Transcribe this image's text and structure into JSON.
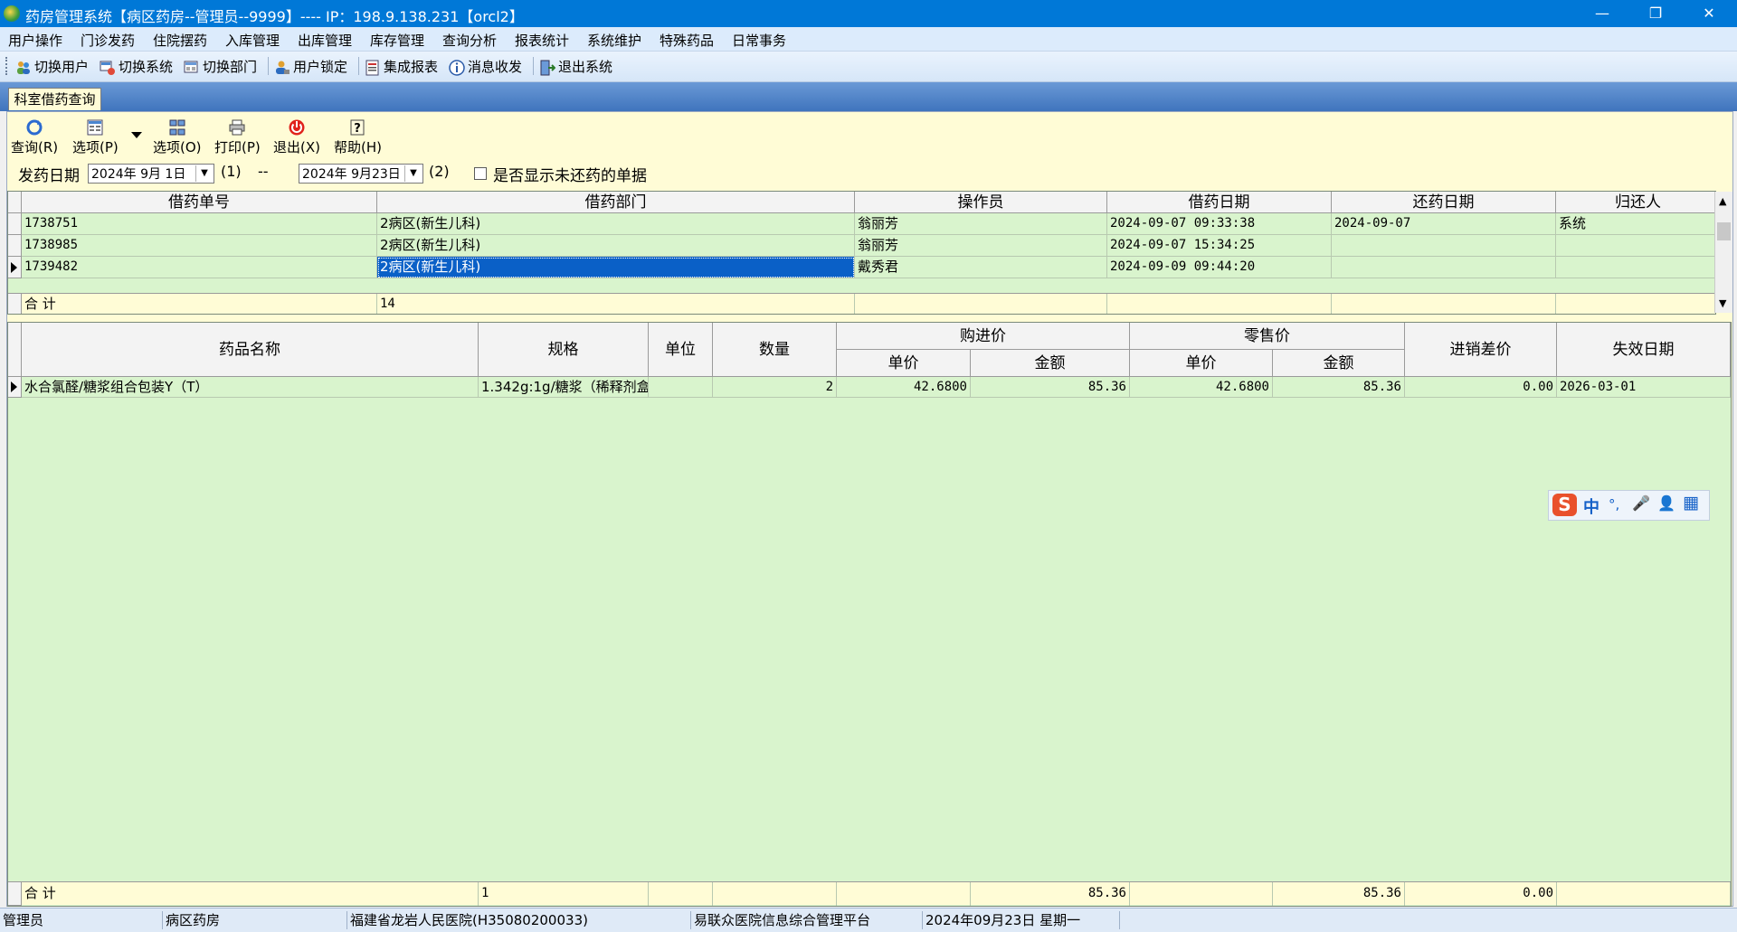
{
  "window": {
    "title": "药房管理系统【病区药房--管理员--9999】---- IP：198.9.138.231【orcl2】",
    "minimize": "—",
    "restore": "❐",
    "close": "✕"
  },
  "menu": [
    "用户操作",
    "门诊发药",
    "住院摆药",
    "入库管理",
    "出库管理",
    "库存管理",
    "查询分析",
    "报表统计",
    "系统维护",
    "特殊药品",
    "日常事务"
  ],
  "toolbar": [
    "切换用户",
    "切换系统",
    "切换部门",
    "用户锁定",
    "集成报表",
    "消息收发",
    "退出系统"
  ],
  "tab": {
    "label": "科室借药查询"
  },
  "actions": {
    "query": "查询(R)",
    "option_p": "选项(P)",
    "option_o": "选项(O)",
    "print": "打印(P)",
    "exit": "退出(X)",
    "help": "帮助(H)"
  },
  "filter": {
    "date_label": "发药日期",
    "date_from": "2024年 9月 1日",
    "date_from_key": "(1)",
    "dash": "--",
    "date_to": "2024年 9月23日",
    "date_to_key": "(2)",
    "show_unreturned_label": "是否显示未还药的单据",
    "show_unreturned_checked": false
  },
  "loan_table": {
    "columns": [
      "借药单号",
      "借药部门",
      "操作员",
      "借药日期",
      "还药日期",
      "归还人"
    ],
    "rows": [
      [
        "1738751",
        "2病区(新生儿科)",
        "翁丽芳",
        "2024-09-07 09:33:38",
        "2024-09-07",
        "系统"
      ],
      [
        "1738985",
        "2病区(新生儿科)",
        "翁丽芳",
        "2024-09-07 15:34:25",
        "",
        ""
      ],
      [
        "1739482",
        "2病区(新生儿科)",
        "戴秀君",
        "2024-09-09 09:44:20",
        "",
        ""
      ]
    ],
    "total_label": "合  计",
    "total_value": "14"
  },
  "detail_table": {
    "columns": {
      "name": "药品名称",
      "spec": "规格",
      "unit": "单位",
      "qty": "数量",
      "purchase_group": "购进价",
      "retail_group": "零售价",
      "unit_price": "单价",
      "amount": "金额",
      "margin": "进销差价",
      "expiry": "失效日期"
    },
    "rows": [
      [
        "水合氯醛/糖浆组合包装Y（T）",
        "1.342g:1g/糖浆（稀释剂盒",
        "",
        "2",
        "42.6800",
        "85.36",
        "42.6800",
        "85.36",
        "0.00",
        "2026-03-01"
      ]
    ],
    "total_label": "合  计",
    "total_spec": "1",
    "total_purchase_amount": "85.36",
    "total_retail_amount": "85.36",
    "total_margin": "0.00"
  },
  "ime": {
    "logo": "S",
    "lang": "中",
    "punct": "°,",
    "mic": "🎤",
    "user": "👤",
    "grid": "▦"
  },
  "status": [
    "管理员",
    "病区药房",
    "福建省龙岩人民医院(H35080200033)",
    "易联众医院信息综合管理平台",
    "2024年09月23日 星期一",
    ""
  ],
  "colors": {
    "title_bar": "#0078d7",
    "grid_bg": "#d9f4cd",
    "panel_bg": "#fffcd6",
    "selection": "#0a60c7"
  }
}
